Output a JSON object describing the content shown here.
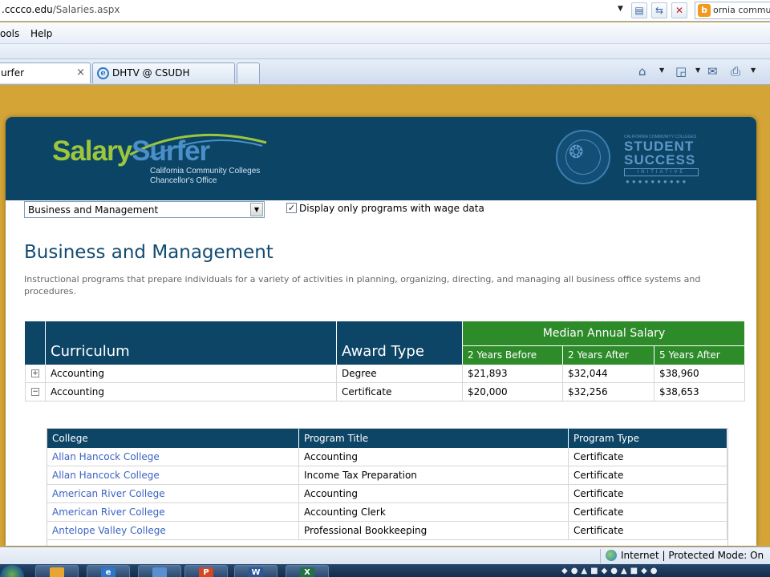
{
  "browser": {
    "url_host": ".cccco.edu",
    "url_path": "/Salaries.aspx",
    "search_text": "ornia commu",
    "search_logo": "b",
    "menu": [
      "ools",
      "Help"
    ],
    "tabs": [
      {
        "label": "urfer",
        "close": "×",
        "active": true
      },
      {
        "label": "DHTV @ CSUDH",
        "active": false
      }
    ]
  },
  "header": {
    "logo_salary": "Salary",
    "logo_surfer": "Surfer",
    "logo_subtitle_1": "California Community Colleges",
    "logo_subtitle_2": "Chancellor's Office",
    "ssi_small": "CALIFORNIA COMMUNITY COLLEGES",
    "ssi_line1": "STUDENT",
    "ssi_line2": "SUCCESS",
    "ssi_line3": "INITIATIVE",
    "ssi_dots": "●●●●●●●●●●"
  },
  "filters": {
    "program": "Business and Management",
    "checkbox_checked": true,
    "checkbox_label": "Display only programs with wage data"
  },
  "program": {
    "title": "Business and Management",
    "description": "Instructional programs that prepare individuals for a variety of activities in planning, organizing, directing, and managing all business office systems and procedures."
  },
  "main_table": {
    "headers": {
      "curriculum": "Curriculum",
      "award_type": "Award Type",
      "median": "Median Annual Salary",
      "before2": "2 Years Before",
      "after2": "2 Years After",
      "after5": "5 Years After"
    },
    "rows": [
      {
        "toggle": "+",
        "curriculum": "Accounting",
        "award": "Degree",
        "before2": "$21,893",
        "after2": "$32,044",
        "after5": "$38,960"
      },
      {
        "toggle": "−",
        "curriculum": "Accounting",
        "award": "Certificate",
        "before2": "$20,000",
        "after2": "$32,256",
        "after5": "$38,653"
      }
    ]
  },
  "detail_table": {
    "headers": {
      "college": "College",
      "program_title": "Program Title",
      "program_type": "Program Type"
    },
    "rows": [
      {
        "college": "Allan Hancock College",
        "program_title": "Accounting",
        "program_type": "Certificate"
      },
      {
        "college": "Allan Hancock College",
        "program_title": "Income Tax Preparation",
        "program_type": "Certificate"
      },
      {
        "college": "American River College",
        "program_title": "Accounting",
        "program_type": "Certificate"
      },
      {
        "college": "American River College",
        "program_title": "Accounting Clerk",
        "program_type": "Certificate"
      },
      {
        "college": "Antelope Valley College",
        "program_title": "Professional Bookkeeping",
        "program_type": "Certificate"
      }
    ]
  },
  "status_bar": {
    "zone": "Internet | Protected Mode: On"
  },
  "colors": {
    "banner": "#0c4466",
    "header_blue": "#0d4567",
    "header_green": "#2e8b2a",
    "page_background": "#d4a437",
    "link": "#3b63c2"
  }
}
